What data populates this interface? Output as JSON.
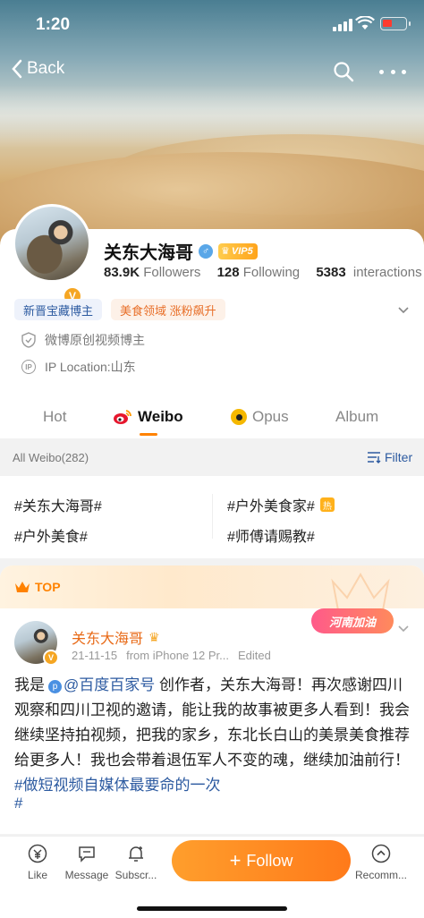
{
  "status_bar": {
    "time": "1:20"
  },
  "nav": {
    "back_label": "Back"
  },
  "profile": {
    "name": "关东大海哥",
    "vip_label": "VIP5",
    "followers_value": "83.9K",
    "followers_label": "Followers",
    "following_value": "128",
    "following_label": "Following",
    "interactions_value": "5383",
    "interactions_label": "interactions",
    "tags": [
      "新晋宝藏博主",
      "美食领域 涨粉飙升"
    ],
    "verification": "微博原创视频博主",
    "ip_location": "IP Location:山东",
    "ip_icon_text": "IP"
  },
  "tabs": [
    {
      "label": "Hot"
    },
    {
      "label": "Weibo"
    },
    {
      "label": "Opus"
    },
    {
      "label": "Album"
    }
  ],
  "filter_bar": {
    "all_label": "All Weibo(282)",
    "filter_label": "Filter"
  },
  "topics": [
    "#关东大海哥#",
    "#户外美食家#",
    "#户外美食#",
    "#师傅请赐教#"
  ],
  "topic_hot_badge": "热",
  "post": {
    "top_label": "TOP",
    "author": "关东大海哥",
    "date": "21-11-15",
    "source": "from iPhone 12 Pr...",
    "edited": "Edited",
    "badge_text": "河南加油",
    "text_prefix": "我是",
    "mention": "@百度百家号",
    "text_body": " 创作者，关东大海哥！再次感谢四川观察和四川卫视的邀请，能让我的故事被更多人看到！我会继续坚持拍视频，把我的家乡，东北长白山的美景美食推荐给更多人！我也会带着退伍军人不变的魂，继续加油前行！",
    "hashtag": "#做短视频自媒体最要命的一次",
    "hashtag_tail": "#"
  },
  "bottom_bar": {
    "like": "Like",
    "message": "Message",
    "subscribe": "Subscr...",
    "follow": "Follow",
    "recommend": "Recomm..."
  },
  "colors": {
    "accent": "#ff8200",
    "link": "#2c5aa0"
  }
}
